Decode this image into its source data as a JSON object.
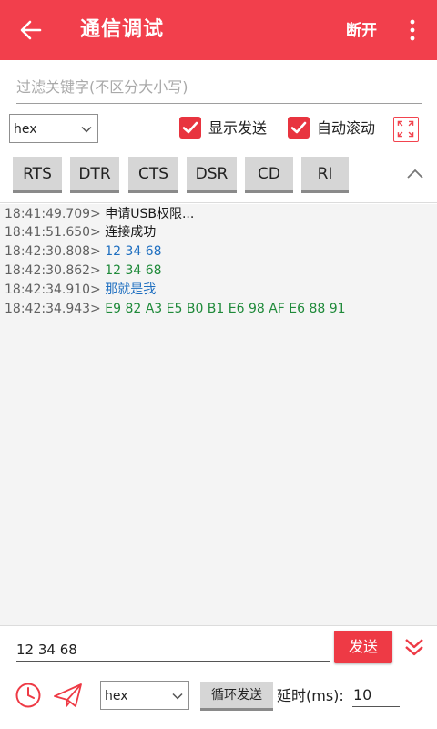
{
  "appbar": {
    "title": "通信调试",
    "action": "断开"
  },
  "filter": {
    "placeholder": "过滤关键字(不区分大小写)",
    "value": ""
  },
  "options": {
    "format": "hex",
    "show_send": {
      "label": "显示发送",
      "checked": true
    },
    "auto_scroll": {
      "label": "自动滚动",
      "checked": true
    }
  },
  "controls": [
    "RTS",
    "DTR",
    "CTS",
    "DSR",
    "CD",
    "RI"
  ],
  "log": [
    {
      "time": "18:41:49.709>",
      "text": "申请USB权限...",
      "kind": "sys"
    },
    {
      "time": "18:41:51.650>",
      "text": "连接成功",
      "kind": "sys"
    },
    {
      "time": "18:42:30.808>",
      "text": "12 34 68",
      "kind": "sent"
    },
    {
      "time": "18:42:30.862>",
      "text": "12 34 68",
      "kind": "recv"
    },
    {
      "time": "18:42:34.910>",
      "text": "那就是我",
      "kind": "sent"
    },
    {
      "time": "18:42:34.943>",
      "text": "E9 82 A3 E5 B0 B1 E6 98 AF E6 88 91",
      "kind": "recv"
    }
  ],
  "send": {
    "value": "12 34 68",
    "button": "发送",
    "format": "hex",
    "loop_button": "循环发送",
    "delay_label": "延时(ms):",
    "delay_value": "10"
  },
  "colors": {
    "primary": "#f23f4c",
    "sent": "#1f6fc0",
    "recv": "#1f8a3a"
  }
}
